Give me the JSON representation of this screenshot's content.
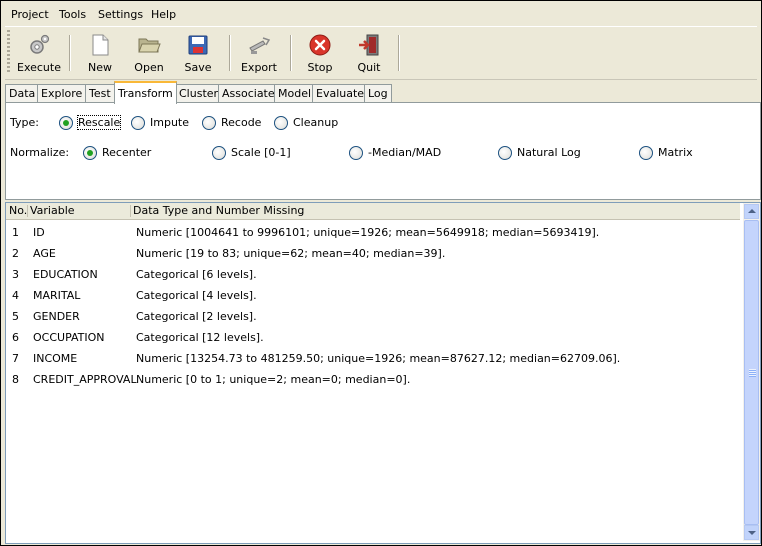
{
  "menu": [
    {
      "label": "Project"
    },
    {
      "label": "Tools"
    },
    {
      "label": "Settings"
    },
    {
      "label": "Help"
    }
  ],
  "toolbar": {
    "execute": "Execute",
    "new": "New",
    "open": "Open",
    "save": "Save",
    "export": "Export",
    "stop": "Stop",
    "quit": "Quit"
  },
  "tabs": [
    "Data",
    "Explore",
    "Test",
    "Transform",
    "Cluster",
    "Associate",
    "Model",
    "Evaluate",
    "Log"
  ],
  "active_tab": "Transform",
  "type_row": {
    "label": "Type:",
    "options": [
      "Rescale",
      "Impute",
      "Recode",
      "Cleanup"
    ],
    "selected": "Rescale"
  },
  "normalize_row": {
    "label": "Normalize:",
    "options": [
      "Recenter",
      "Scale [0-1]",
      "-Median/MAD",
      "Natural Log",
      "Matrix"
    ],
    "selected": "Recenter"
  },
  "table": {
    "headers": [
      "No.",
      "Variable",
      "Data Type and Number Missing"
    ],
    "rows": [
      {
        "no": "1",
        "variable": "ID",
        "info": "Numeric [1004641 to 9996101; unique=1926; mean=5649918; median=5693419]."
      },
      {
        "no": "2",
        "variable": "AGE",
        "info": "Numeric [19 to 83; unique=62; mean=40; median=39]."
      },
      {
        "no": "3",
        "variable": "EDUCATION",
        "info": "Categorical [6 levels]."
      },
      {
        "no": "4",
        "variable": "MARITAL",
        "info": "Categorical [4 levels]."
      },
      {
        "no": "5",
        "variable": "GENDER",
        "info": "Categorical [2 levels]."
      },
      {
        "no": "6",
        "variable": "OCCUPATION",
        "info": "Categorical [12 levels]."
      },
      {
        "no": "7",
        "variable": "INCOME",
        "info": "Numeric [13254.73 to 481259.50; unique=1926; mean=87627.12; median=62709.06]."
      },
      {
        "no": "8",
        "variable": "CREDIT_APPROVAL",
        "info": "Numeric [0 to 1; unique=2; mean=0; median=0]."
      }
    ]
  },
  "colors": {
    "tab_accent": "#f9b838",
    "radio_selected": "#21a121",
    "stop_icon": "#d9352b"
  },
  "icons": [
    "gear-icon",
    "new-document-icon",
    "folder-open-icon",
    "floppy-disk-icon",
    "export-icon",
    "stop-icon",
    "quit-door-icon"
  ]
}
